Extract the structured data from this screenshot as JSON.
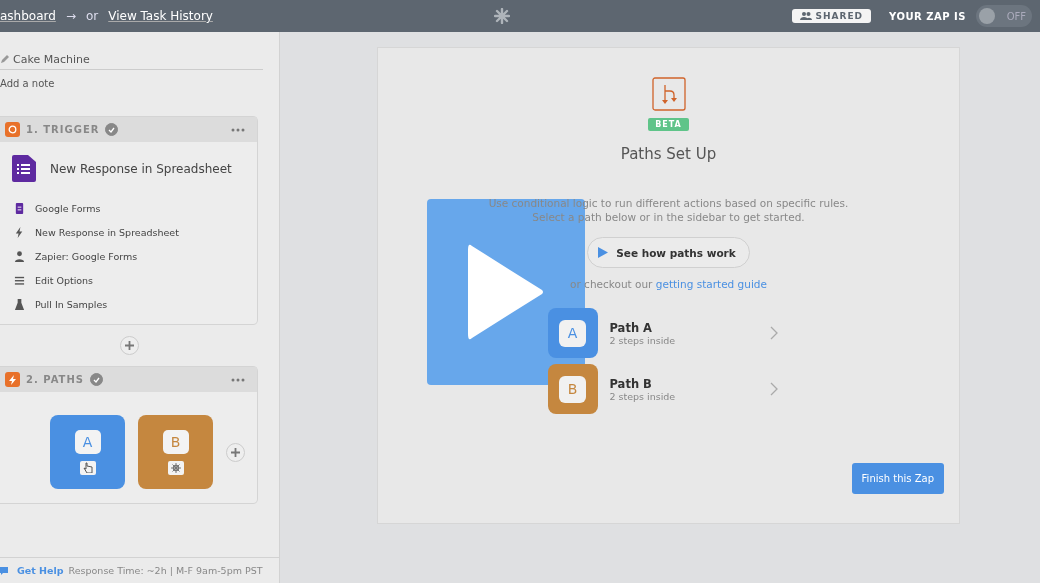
{
  "top_bar": {
    "breadcrumb": "ashboard",
    "arrow": "→",
    "separator": "or",
    "history_link": "View Task History",
    "shared_badge": "SHARED",
    "zap_status_label": "YOUR ZAP IS",
    "zap_toggle": {
      "on": false,
      "label": "OFF"
    }
  },
  "sidebar": {
    "zap_name": "Cake Machine",
    "note": "Add a note",
    "trigger": {
      "title": "1. TRIGGER",
      "done": true,
      "app_title": "New Response in Spreadsheet",
      "details": [
        {
          "kind": "app",
          "label": "Google Forms"
        },
        {
          "kind": "event",
          "label": "New Response in Spreadsheet"
        },
        {
          "kind": "account",
          "label": "Zapier: Google Forms"
        },
        {
          "kind": "options",
          "label": "Edit Options"
        },
        {
          "kind": "test",
          "label": "Pull In Samples"
        }
      ]
    },
    "paths_step": {
      "title": "2. PATHS",
      "done": true,
      "paths": [
        {
          "letter": "A",
          "color": "#4a90e2",
          "kind": "pointer"
        },
        {
          "letter": "B",
          "color": "#c5873f",
          "kind": "gear"
        }
      ]
    },
    "footer": {
      "help_link": "Get Help",
      "response_time": "Response Time: ~2h | M-F 9am-5pm PST"
    }
  },
  "main": {
    "badge": "BETA",
    "title": "Paths Set Up",
    "description": [
      "Use conditional logic to run different actions based on specific rules.",
      "Select a path below or in the sidebar to get started."
    ],
    "video_button": "See how paths work",
    "guide_prefix": "or checkout our",
    "guide_link": "getting started guide",
    "paths": [
      {
        "letter": "A",
        "name": "Path A",
        "subtitle": "2 steps inside",
        "color": "#4a90e2"
      },
      {
        "letter": "B",
        "name": "Path B",
        "subtitle": "2 steps inside",
        "color": "#c5873f"
      }
    ],
    "finish_button": "Finish this Zap"
  }
}
